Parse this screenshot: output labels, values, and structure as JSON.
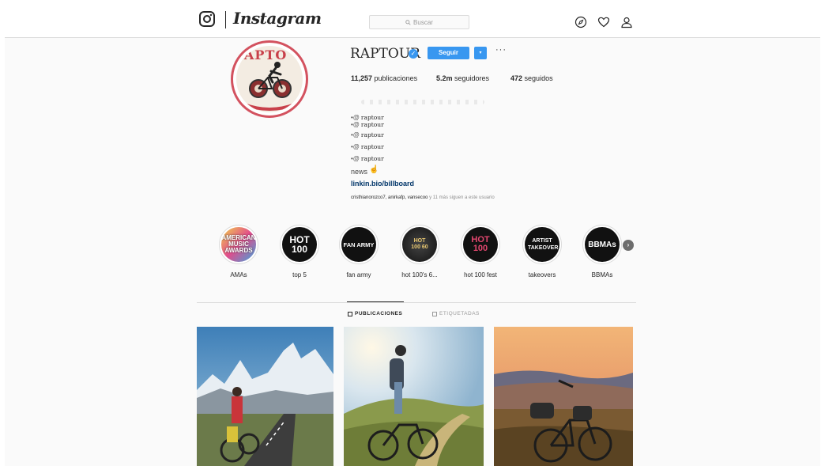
{
  "header": {
    "brand": "Instagram",
    "search": {
      "placeholder": "Buscar"
    },
    "icons": [
      "compass-icon",
      "heart-icon",
      "user-icon"
    ]
  },
  "profile": {
    "username": "RAPTOUR",
    "verified": true,
    "follow_label": "Seguir",
    "dropdown_label": "▾",
    "more_label": "···",
    "avatar_text": "APTO",
    "stats": {
      "posts_count": "11,257",
      "posts_label": "publicaciones",
      "followers_count": "5.2m",
      "followers_label": "seguidores",
      "following_count": "472",
      "following_label": "seguidos"
    },
    "bio_lines": [
      "raptour",
      "raptour",
      "raptour",
      "raptour",
      "raptour"
    ],
    "bio_news": "news",
    "link": "linkin.bio/billboard",
    "followed_by_users": "cristhianorozco7, anirkafp, vansecoo",
    "followed_by_rest": "y 11 más siguen a este usuario"
  },
  "highlights": [
    {
      "label": "AMAs",
      "art": "AMERICAN MUSIC AWARDS"
    },
    {
      "label": "top 5",
      "art": "HOT 100"
    },
    {
      "label": "fan army",
      "art": "FAN ARMY"
    },
    {
      "label": "hot 100's 6...",
      "art": "HOT 100 60"
    },
    {
      "label": "hot 100 fest",
      "art": "HOT 100"
    },
    {
      "label": "takeovers",
      "art": "ARTIST TAKEOVER"
    },
    {
      "label": "BBMAs",
      "art": "BBMAs"
    }
  ],
  "tabs": {
    "posts": "PUBLICACIONES",
    "tagged": "ETIQUETADAS"
  },
  "colors": {
    "accent": "#3897f0",
    "link": "#003569",
    "ring": "#d3525f"
  }
}
